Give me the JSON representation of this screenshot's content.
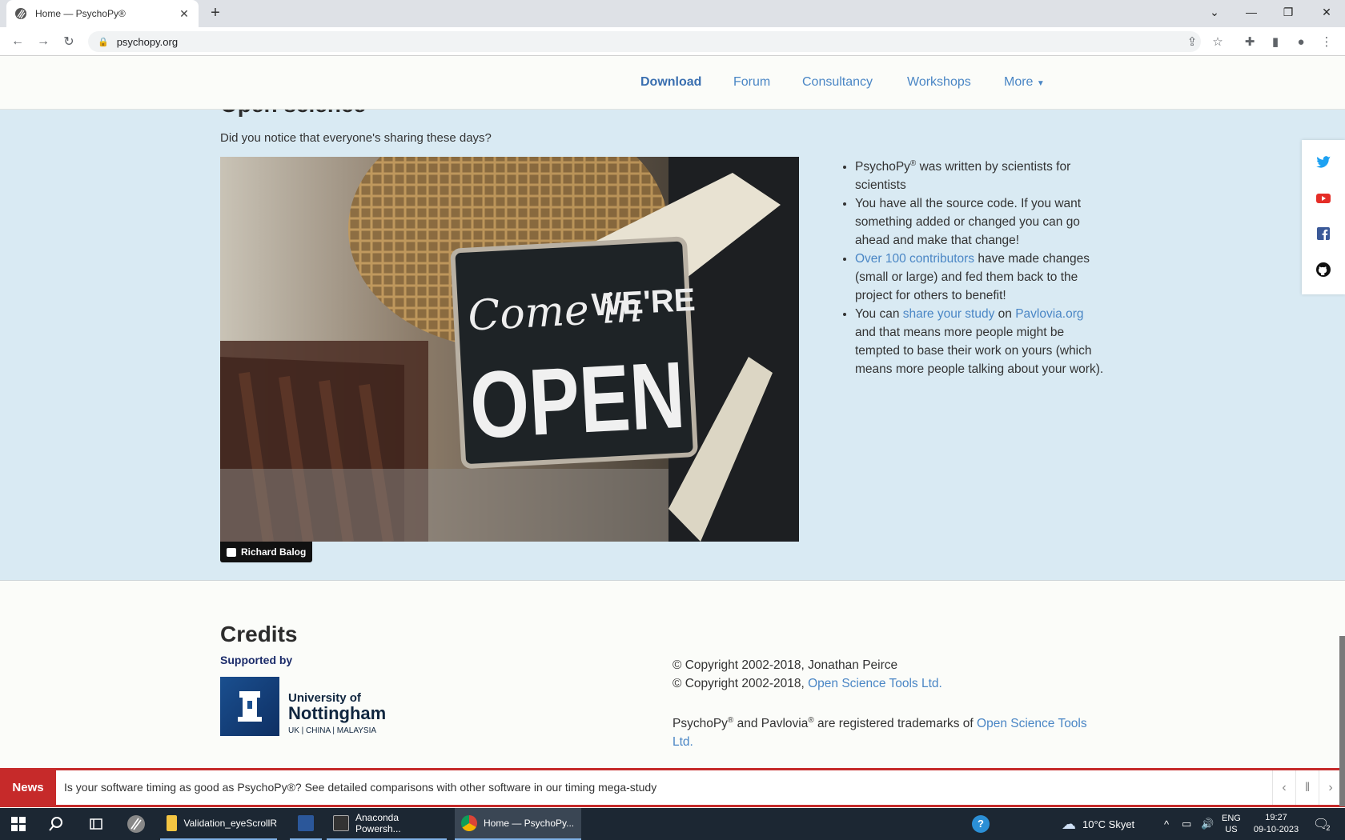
{
  "browser": {
    "tab_title": "Home — PsychoPy®",
    "url": "psychopy.org",
    "new_tab_symbol": "+"
  },
  "nav": {
    "items": [
      "Download",
      "Forum",
      "Consultancy",
      "Workshops",
      "More"
    ],
    "active": "Download"
  },
  "open_science": {
    "heading": "Open science",
    "subtitle": "Did you notice that everyone's sharing these days?",
    "photo_credit": "Richard Balog",
    "bullets": {
      "b1_a": "PsychoPy",
      "b1_sup": "®",
      "b1_b": " was written by scientists for scientists",
      "b2": "You have all the source code. If you want something added or changed you can go ahead and make that change!",
      "b3_link": "Over 100 contributors",
      "b3_rest": " have made changes (small or large) and fed them back to the project for others to benefit!",
      "b4_a": "You can ",
      "b4_link1": "share your study",
      "b4_b": " on ",
      "b4_link2": "Pavlovia.org",
      "b4_c": " and that means more people might be tempted to base their work on yours (which means more people talking about your work)."
    }
  },
  "credits": {
    "heading": "Credits",
    "supported_by": "Supported by",
    "uni_line1": "University of",
    "uni_line2": "Nottingham",
    "uni_line3": "UK | CHINA | MALAYSIA",
    "copy1": "© Copyright 2002-2018, Jonathan Peirce",
    "copy2_a": "© Copyright 2002-2018, ",
    "copy2_link": "Open Science Tools Ltd.",
    "tm_a": "PsychoPy",
    "tm_sup1": "®",
    "tm_b": " and Pavlovia",
    "tm_sup2": "®",
    "tm_c": " are registered trademarks of ",
    "tm_link": "Open Science Tools Ltd."
  },
  "news": {
    "label": "News",
    "text": "Is your software timing as good as PsychoPy®? See detailed comparisons with other software in our timing mega-study"
  },
  "taskbar": {
    "apps": [
      "Validation_eyeScrollR",
      "Anaconda Powersh...",
      "Home — PsychoPy..."
    ],
    "weather": "10°C Skyet",
    "lang1": "ENG",
    "lang2": "US",
    "time": "19:27",
    "date": "09-10-2023",
    "notif_count": "2"
  },
  "colors": {
    "accent_link": "#4a86c5",
    "section_bg": "#d9eaf3",
    "news_red": "#c62a2a",
    "taskbar": "#1c2733"
  }
}
